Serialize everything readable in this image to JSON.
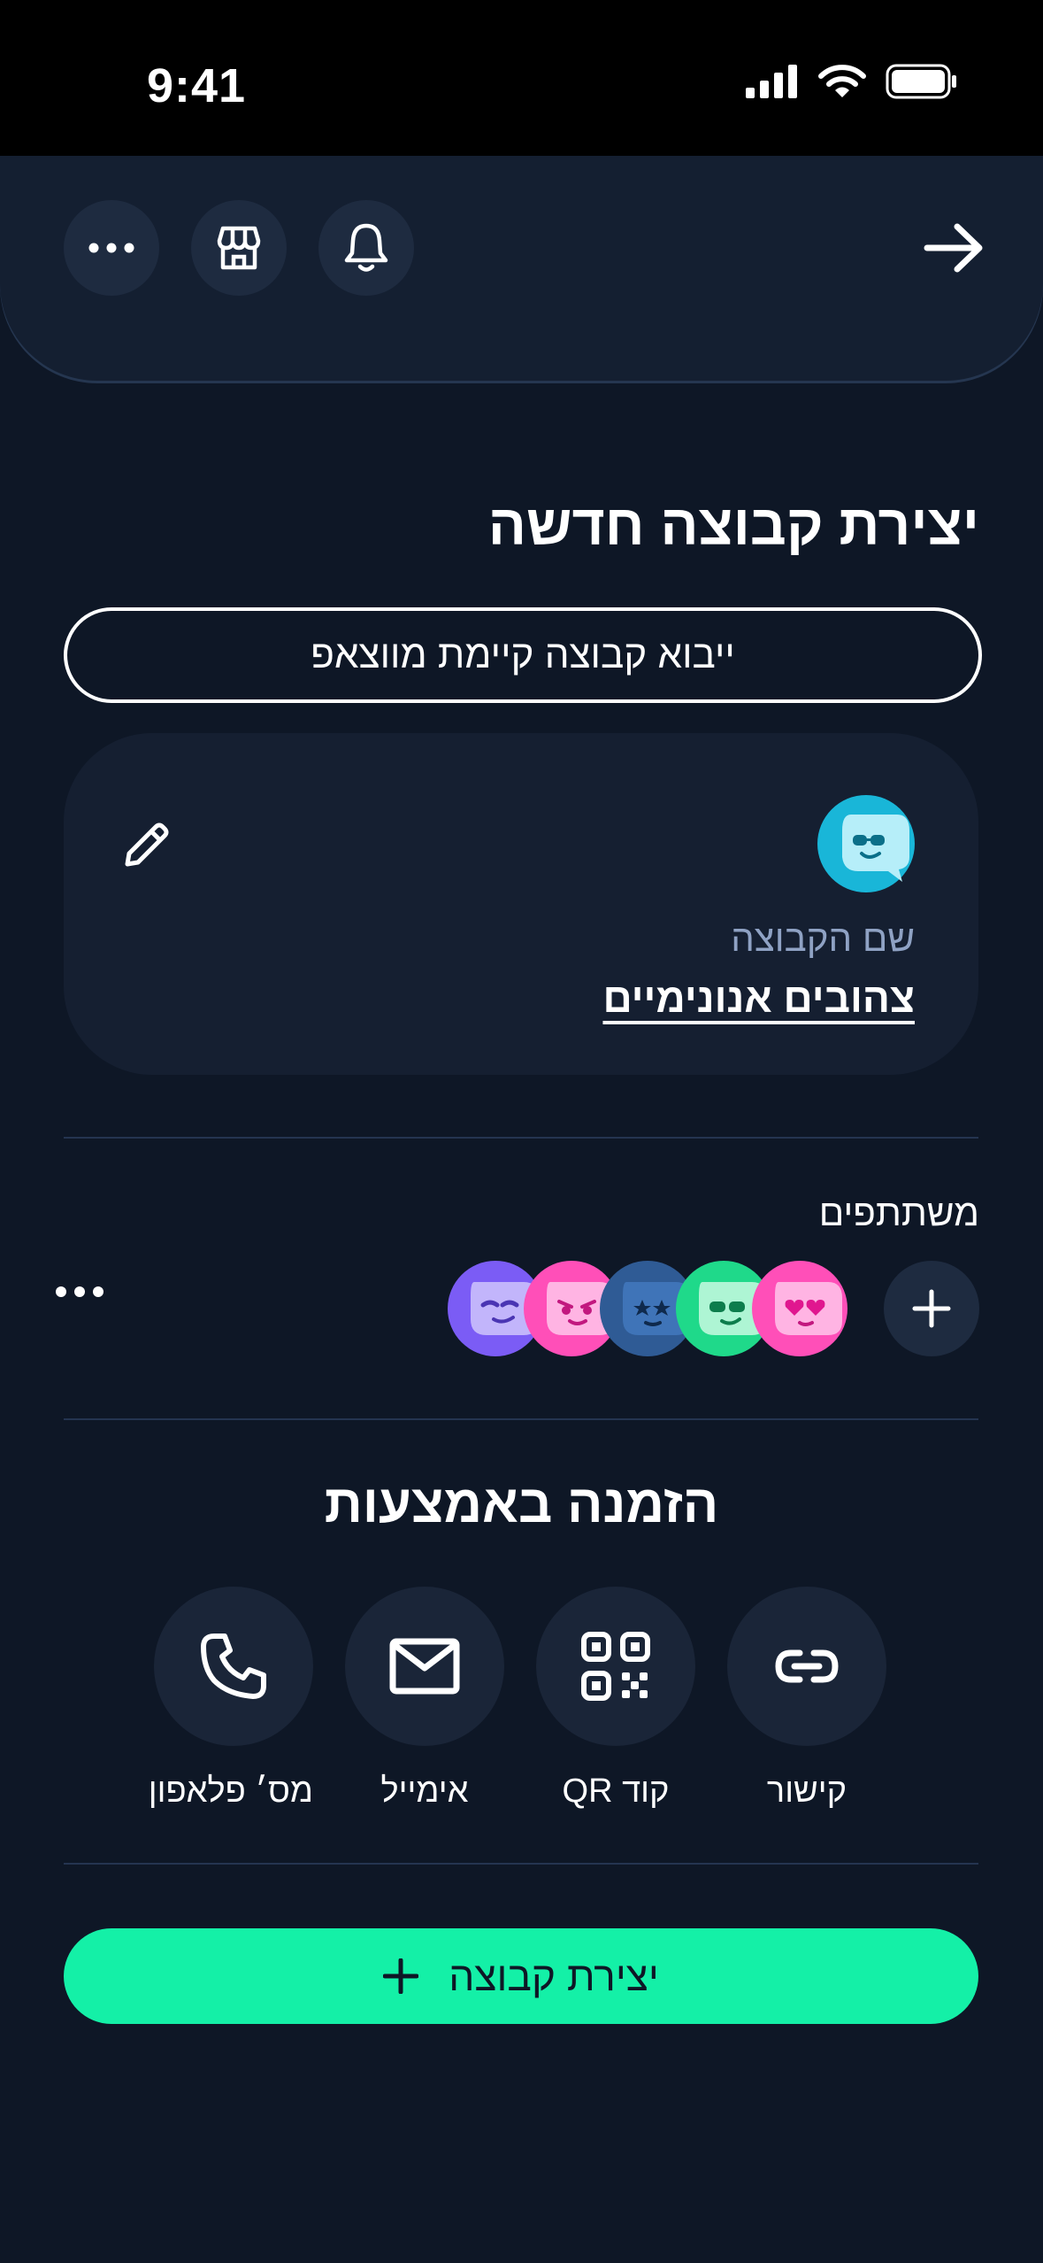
{
  "status": {
    "time": "9:41"
  },
  "header": {
    "more_icon": "more-dots-icon",
    "store_icon": "store-icon",
    "bell_icon": "bell-icon",
    "back_icon": "arrow-right-icon"
  },
  "page": {
    "title": "יצירת קבוצה חדשה",
    "import_button": "ייבוא קבוצה קיימת מווצאפ"
  },
  "group": {
    "label": "שם הקבוצה",
    "name": "צהובים אנונימיים"
  },
  "participants": {
    "label": "משתתפים",
    "avatar_colors": [
      "#ff4fb8",
      "#1fd98a",
      "#2f5b95",
      "#ff4fb8",
      "#7b5cf5"
    ]
  },
  "invite": {
    "title": "הזמנה באמצעות",
    "options": [
      {
        "label": "קישור",
        "icon": "link-icon"
      },
      {
        "label": "קוד QR",
        "icon": "qr-code-icon"
      },
      {
        "label": "אימייל",
        "icon": "mail-icon"
      },
      {
        "label": "מס׳ פלאפון",
        "icon": "phone-icon"
      }
    ]
  },
  "create_button": {
    "label": "יצירת קבוצה"
  },
  "colors": {
    "accent": "#14f0a7",
    "background": "#0e1726",
    "card": "#151f31"
  }
}
